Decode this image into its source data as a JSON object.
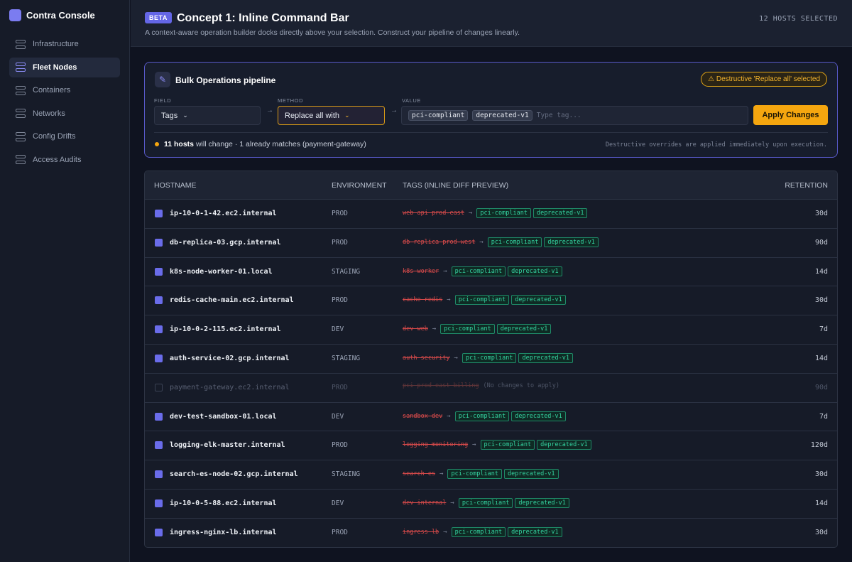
{
  "app": {
    "name": "Contra Console"
  },
  "sidebar": {
    "items": [
      {
        "label": "Infrastructure",
        "active": false
      },
      {
        "label": "Fleet Nodes",
        "active": true
      },
      {
        "label": "Containers",
        "active": false
      },
      {
        "label": "Networks",
        "active": false
      },
      {
        "label": "Config Drifts",
        "active": false
      },
      {
        "label": "Access Audits",
        "active": false
      }
    ]
  },
  "header": {
    "badge": "BETA",
    "title": "Concept 1: Inline Command Bar",
    "subtitle": "A context-aware operation builder docks directly above your selection. Construct your pipeline of changes linearly.",
    "hosts_selected": "12 HOSTS SELECTED"
  },
  "panel": {
    "title": "Bulk Operations pipeline",
    "warning": "Destructive 'Replace all' selected",
    "field_label": "FIELD",
    "field_value": "Tags",
    "method_label": "METHOD",
    "method_value": "Replace all with",
    "value_label": "VALUE",
    "value_chips": [
      "pci-compliant",
      "deprecated-v1"
    ],
    "value_placeholder": "Type tag...",
    "apply_label": "Apply Changes",
    "summary_bold": "11 hosts",
    "summary_rest": "will change · 1 already matches (payment-gateway)",
    "exec_note": "Destructive overrides are applied immediately upon execution."
  },
  "table": {
    "headers": [
      "HOSTNAME",
      "ENVIRONMENT",
      "TAGS (INLINE DIFF PREVIEW)",
      "RETENTION"
    ],
    "rows": [
      {
        "host": "ip-10-0-1-42.ec2.internal",
        "env": "PROD",
        "old_tags": "web api prod-east",
        "new_tags": [
          "pci-compliant",
          "deprecated-v1"
        ],
        "retention": "30d",
        "selected": true
      },
      {
        "host": "db-replica-03.gcp.internal",
        "env": "PROD",
        "old_tags": "db replica prod-west",
        "new_tags": [
          "pci-compliant",
          "deprecated-v1"
        ],
        "retention": "90d",
        "selected": true
      },
      {
        "host": "k8s-node-worker-01.local",
        "env": "STAGING",
        "old_tags": "k8s worker",
        "new_tags": [
          "pci-compliant",
          "deprecated-v1"
        ],
        "retention": "14d",
        "selected": true
      },
      {
        "host": "redis-cache-main.ec2.internal",
        "env": "PROD",
        "old_tags": "cache redis",
        "new_tags": [
          "pci-compliant",
          "deprecated-v1"
        ],
        "retention": "30d",
        "selected": true
      },
      {
        "host": "ip-10-0-2-115.ec2.internal",
        "env": "DEV",
        "old_tags": "dev web",
        "new_tags": [
          "pci-compliant",
          "deprecated-v1"
        ],
        "retention": "7d",
        "selected": true
      },
      {
        "host": "auth-service-02.gcp.internal",
        "env": "STAGING",
        "old_tags": "auth security",
        "new_tags": [
          "pci-compliant",
          "deprecated-v1"
        ],
        "retention": "14d",
        "selected": true
      },
      {
        "host": "payment-gateway.ec2.internal",
        "env": "PROD",
        "old_tags": "pci prod-east billing",
        "new_tags": [],
        "note": "(No changes to apply)",
        "retention": "90d",
        "selected": false
      },
      {
        "host": "dev-test-sandbox-01.local",
        "env": "DEV",
        "old_tags": "sandbox dev",
        "new_tags": [
          "pci-compliant",
          "deprecated-v1"
        ],
        "retention": "7d",
        "selected": true
      },
      {
        "host": "logging-elk-master.internal",
        "env": "PROD",
        "old_tags": "logging monitoring",
        "new_tags": [
          "pci-compliant",
          "deprecated-v1"
        ],
        "retention": "120d",
        "selected": true
      },
      {
        "host": "search-es-node-02.gcp.internal",
        "env": "STAGING",
        "old_tags": "search es",
        "new_tags": [
          "pci-compliant",
          "deprecated-v1"
        ],
        "retention": "30d",
        "selected": true
      },
      {
        "host": "ip-10-0-5-88.ec2.internal",
        "env": "DEV",
        "old_tags": "dev internal",
        "new_tags": [
          "pci-compliant",
          "deprecated-v1"
        ],
        "retention": "14d",
        "selected": true
      },
      {
        "host": "ingress-nginx-lb.internal",
        "env": "PROD",
        "old_tags": "ingress lb",
        "new_tags": [
          "pci-compliant",
          "deprecated-v1"
        ],
        "retention": "30d",
        "selected": true
      }
    ]
  },
  "colors": {
    "accent": "#6466e6",
    "warning": "#f5a60f",
    "added_tag": "#34d3a0",
    "removed_tag": "#d64a4a"
  }
}
